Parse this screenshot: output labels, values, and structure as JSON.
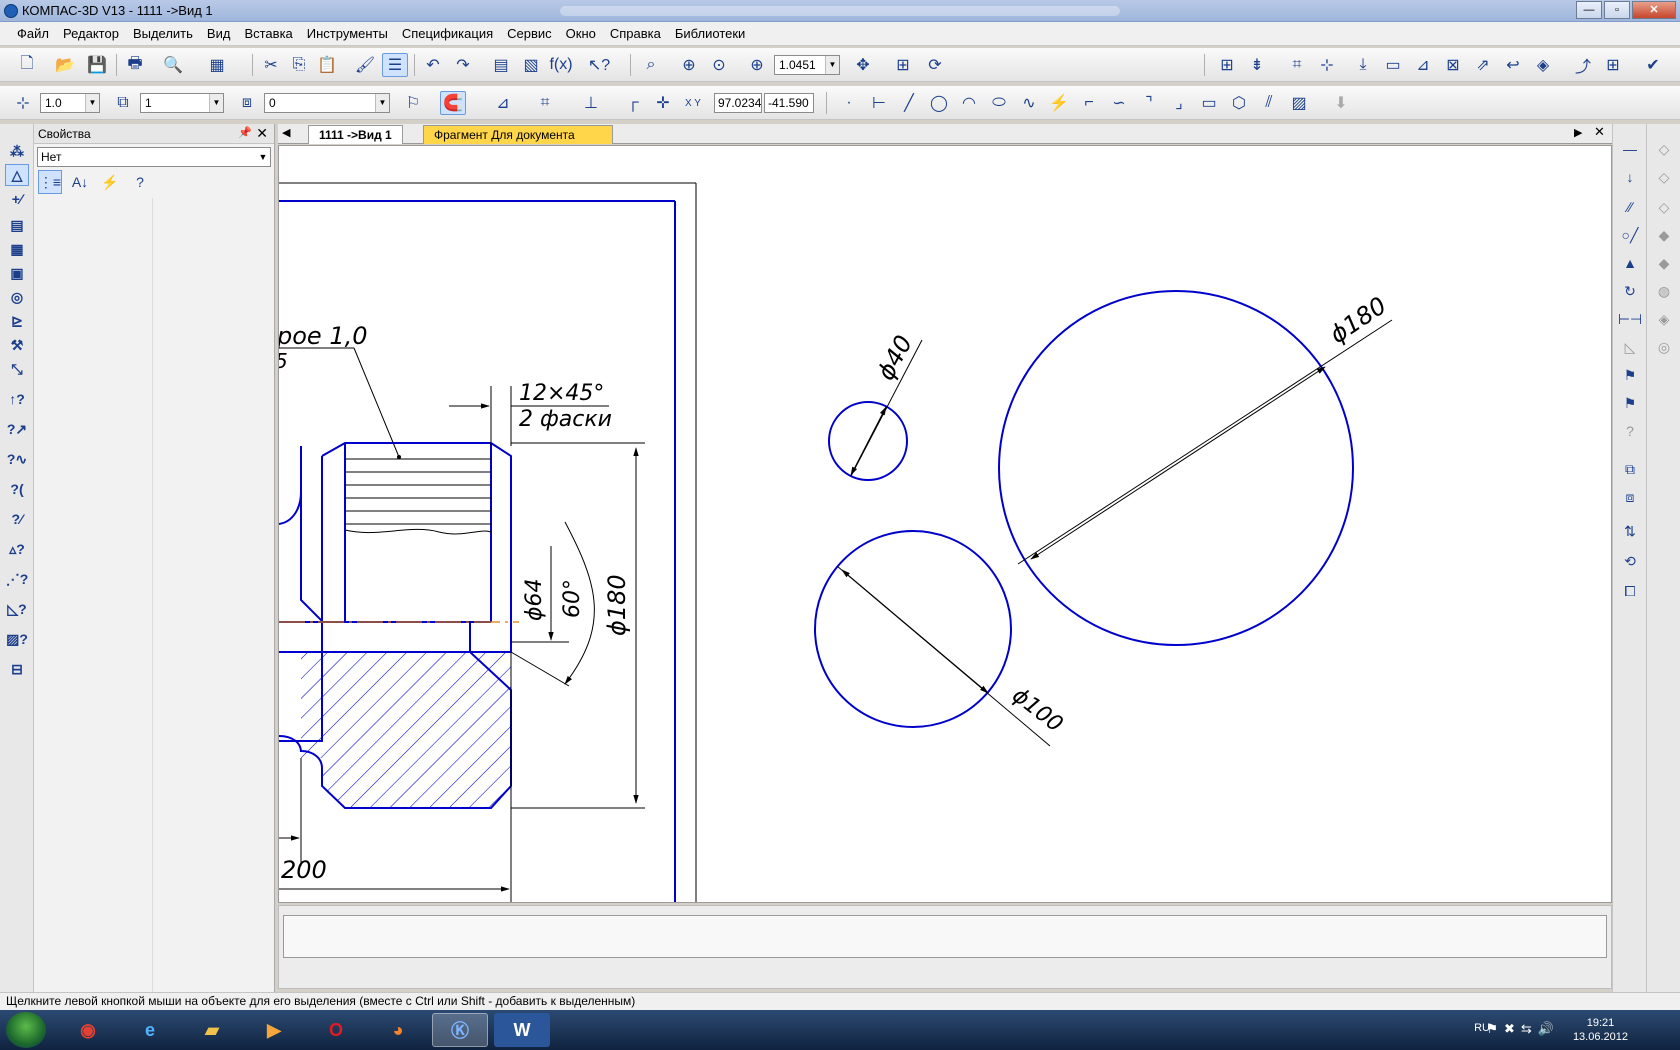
{
  "window": {
    "title": "КОМПАС-3D V13 - 1111 ->Вид 1",
    "minimize": "—",
    "maximize": "▫",
    "close": "✕"
  },
  "menu": [
    "Файл",
    "Редактор",
    "Выделить",
    "Вид",
    "Вставка",
    "Инструменты",
    "Спецификация",
    "Сервис",
    "Окно",
    "Справка",
    "Библиотеки"
  ],
  "toolbar": {
    "zoom_value": "1.0451",
    "line_scale": "1.0",
    "layer_state": "1",
    "layer": "0",
    "coord_x": "97.0234",
    "coord_y": "-41.590"
  },
  "properties": {
    "title": "Свойства",
    "filter_value": "Нет"
  },
  "tabs": {
    "doc": "1111 ->Вид 1",
    "fragment": "Фрагмент Для документа"
  },
  "drawing": {
    "label_fillet": "рое 1,0",
    "label_5": "5",
    "label_chamfer": "12×45°",
    "label_chamfer_count": "2 фаски",
    "label_d64": "ϕ64",
    "label_60": "60°",
    "label_d180_left": "ϕ180",
    "label_200": "200",
    "label_d40": "ϕ40",
    "label_d180_right": "ϕ180",
    "label_d100": "ϕ100"
  },
  "status": {
    "message": "Щелкните левой кнопкой мыши на объекте для его выделения (вместе с Ctrl или Shift - добавить к выделенным)"
  },
  "taskbar": {
    "lang": "RU",
    "time": "19:21",
    "date": "13.06.2012"
  },
  "colors": {
    "contour": "#0000cc",
    "axis": "#e07b00",
    "fragment_tab": "#ffd54a"
  }
}
